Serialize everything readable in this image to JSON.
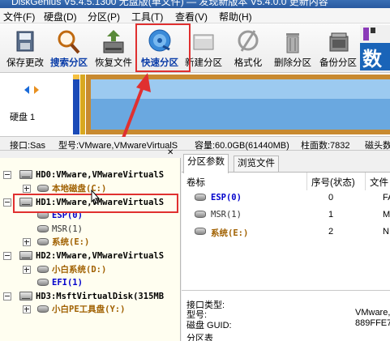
{
  "window": {
    "title": "DiskGenius V5.4.5.1300 无盘版(单文件) — 发现新版本 V5.4.0.0 更新内容"
  },
  "menu": [
    "文件(F)",
    "硬盘(D)",
    "分区(P)",
    "工具(T)",
    "查看(V)",
    "帮助(H)"
  ],
  "toolbar": [
    {
      "label": "保存更改",
      "icon": "save-icon"
    },
    {
      "label": "搜索分区",
      "icon": "search-partition-icon"
    },
    {
      "label": "恢复文件",
      "icon": "recover-file-icon"
    },
    {
      "label": "快速分区",
      "icon": "quick-partition-icon"
    },
    {
      "label": "新建分区",
      "icon": "new-partition-icon"
    },
    {
      "label": "格式化",
      "icon": "format-icon"
    },
    {
      "label": "删除分区",
      "icon": "delete-partition-icon"
    },
    {
      "label": "备份分区",
      "icon": "backup-partition-icon"
    }
  ],
  "ad": {
    "text": "数"
  },
  "diskmap": {
    "label": "硬盘 1"
  },
  "diskinfo": {
    "interface": "接口:Sas",
    "model": "型号:VMware,VMwareVirtualS",
    "capacity": "容量:60.0GB(61440MB)",
    "cylinders": "柱面数:7832",
    "heads": "磁头数"
  },
  "tree": [
    {
      "text": "HD0:VMware,VMwareVirtualS",
      "level": 0,
      "color": "bold",
      "expand": "minus"
    },
    {
      "text": "本地磁盘(C:)",
      "level": 1,
      "color": "brown",
      "expand": "plus"
    },
    {
      "text": "HD1:VMware,VMwareVirtualS",
      "level": 0,
      "color": "bold",
      "expand": "minus"
    },
    {
      "text": "ESP(0)",
      "level": 1,
      "color": "blue",
      "expand": "none"
    },
    {
      "text": "MSR(1)",
      "level": 1,
      "color": "dark",
      "expand": "none"
    },
    {
      "text": "系统(E:)",
      "level": 1,
      "color": "brown",
      "expand": "plus"
    },
    {
      "text": "HD2:VMware,VMwareVirtualS",
      "level": 0,
      "color": "bold",
      "expand": "minus"
    },
    {
      "text": "小白系统(D:)",
      "level": 1,
      "color": "brown",
      "expand": "plus"
    },
    {
      "text": "EFI(1)",
      "level": 1,
      "color": "blue",
      "expand": "none"
    },
    {
      "text": "HD3:MsftVirtualDisk(315MB",
      "level": 0,
      "color": "bold",
      "expand": "minus"
    },
    {
      "text": "小白PE工具盘(Y:)",
      "level": 1,
      "color": "brown",
      "expand": "plus"
    }
  ],
  "tabs": [
    "分区参数",
    "浏览文件"
  ],
  "table": {
    "headers": {
      "label": "卷标",
      "seq": "序号(状态)",
      "fs": "文件"
    },
    "rows": [
      {
        "name": "ESP(0)",
        "seq": "0",
        "fs": "FA",
        "color": "blue"
      },
      {
        "name": "MSR(1)",
        "seq": "1",
        "fs": "M",
        "color": "dark"
      },
      {
        "name": "系统(E:)",
        "seq": "2",
        "fs": "N",
        "color": "brown"
      }
    ]
  },
  "details": {
    "iface": "接口类型:",
    "model": "型号:",
    "model_val": "VMware,",
    "guid": "磁盘 GUID:",
    "guid_val": "889FFE7",
    "last": "分区表"
  }
}
